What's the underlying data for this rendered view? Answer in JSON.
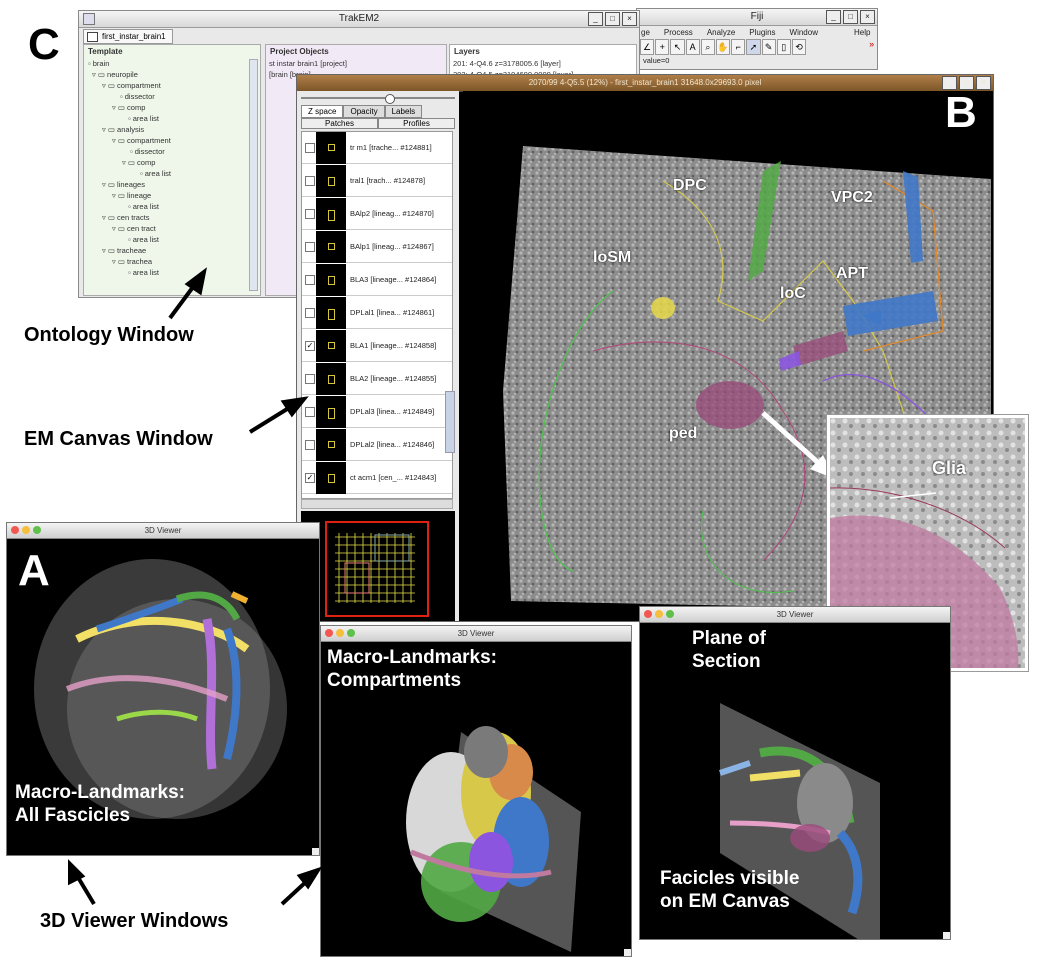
{
  "figure_letters": {
    "a": "A",
    "b": "B",
    "c": "C"
  },
  "trakem2": {
    "title": "TrakEM2",
    "tab": "first_instar_brain1",
    "template_header": "Template",
    "project_header": "Project Objects",
    "layers_header": "Layers",
    "template_tree": [
      "brain",
      "neuropile",
      "compartment",
      "dissector",
      "comp",
      "area list",
      "analysis",
      "compartment",
      "dissector",
      "comp",
      "area list",
      "lineages",
      "lineage",
      "area list",
      "cen tracts",
      "cen tract",
      "area list",
      "tracheae",
      "trachea",
      "area list"
    ],
    "project_items": [
      "st instar brain1 [project]",
      "[brain [brain]"
    ],
    "layers": [
      "201: 4-Q4.6 z=3178005.6 [layer]",
      "202: 4-Q4.5 z=3194600.0000 [layer]"
    ]
  },
  "fiji": {
    "title": "Fiji",
    "menus": [
      "ge",
      "Process",
      "Analyze",
      "Plugins",
      "Window",
      "Help"
    ],
    "status": "value=0"
  },
  "em_canvas": {
    "title": "2070/99 4-Q5.5 (12%) - first_instar_brain1 31648.0x29693.0 pixel",
    "tabs": [
      "Z space",
      "Opacity",
      "Labels"
    ],
    "subtabs": [
      "Patches",
      "Profiles"
    ],
    "rows": [
      "tr m1 [trache... #124881]",
      "tral1 [trach... #124878]",
      "BAlp2 [lineag... #124870]",
      "BAlp1 [lineag... #124867]",
      "BLA3 [lineage... #124864]",
      "DPLal1 [linea... #124861]",
      "BLA1 [lineage... #124858]",
      "BLA2 [lineage... #124855]",
      "DPLal3 [linea... #124849]",
      "DPLal2 [linea... #124846]",
      "ct acm1 [cen_... #124843]"
    ],
    "checked": [
      false,
      false,
      false,
      false,
      false,
      false,
      true,
      false,
      false,
      false,
      true
    ],
    "labels": {
      "dpc": "DPC",
      "vpc2": "VPC2",
      "losm": "loSM",
      "apt": "APT",
      "loc": "loC",
      "ped": "ped",
      "glia": "Glia"
    }
  },
  "viewer_title": "3D Viewer",
  "viewer_a_text": [
    "Macro-Landmarks:",
    "All Fascicles"
  ],
  "viewer_b_text": [
    "Macro-Landmarks:",
    "Compartments"
  ],
  "viewer_c_top": [
    "Plane of",
    "Section"
  ],
  "viewer_c_bottom": [
    "Facicles visible",
    "on EM Canvas"
  ],
  "annotations": {
    "ontology": "Ontology Window",
    "em_canvas": "EM Canvas Window",
    "viewers": "3D Viewer Windows"
  },
  "colors": {
    "mac_red": "#f2584f",
    "mac_yellow": "#f5be3c",
    "mac_green": "#5fc04a",
    "highlight_purple": "#c07aa0"
  }
}
